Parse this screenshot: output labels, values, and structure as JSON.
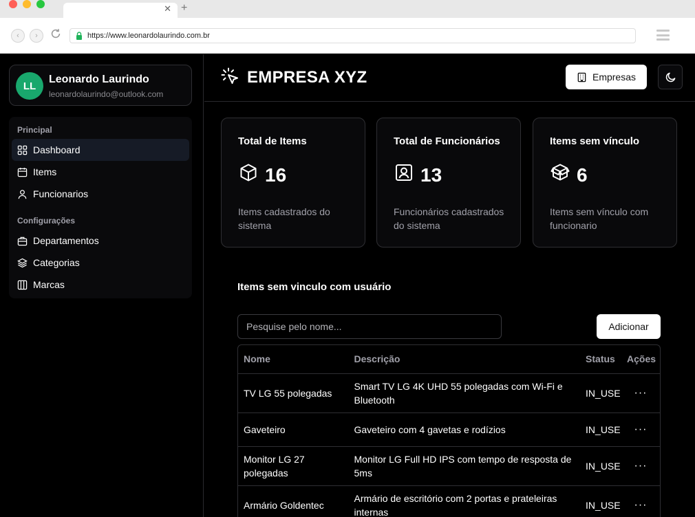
{
  "browser": {
    "url": "https://www.leonardolaurindo.com.br",
    "tab_close": "✕",
    "tab_new": "+"
  },
  "profile": {
    "initials": "LL",
    "name": "Leonardo Laurindo",
    "email": "leonardolaurindo@outlook.com"
  },
  "sidebar": {
    "sections": [
      {
        "title": "Principal",
        "items": [
          {
            "label": "Dashboard",
            "icon": "grid-icon",
            "active": true
          },
          {
            "label": "Items",
            "icon": "calendar-icon"
          },
          {
            "label": "Funcionarios",
            "icon": "user-icon"
          }
        ]
      },
      {
        "title": "Configurações",
        "items": [
          {
            "label": "Departamentos",
            "icon": "briefcase-icon"
          },
          {
            "label": "Categorias",
            "icon": "layers-icon"
          },
          {
            "label": "Marcas",
            "icon": "columns-icon"
          }
        ]
      }
    ]
  },
  "header": {
    "brand": "EMPRESA XYZ",
    "brand_icon": "cursor-click-icon",
    "empresas_label": "Empresas",
    "theme_icon": "moon-icon"
  },
  "cards": [
    {
      "title": "Total de Items",
      "value": "16",
      "desc": "Items cadastrados do sistema",
      "icon": "box-icon"
    },
    {
      "title": "Total de Funcionários",
      "value": "13",
      "desc": "Funcionários cadastrados do sistema",
      "icon": "contact-icon"
    },
    {
      "title": "Items sem vínculo",
      "value": "6",
      "desc": "Items sem vínculo com funcionario",
      "icon": "package-open-icon"
    }
  ],
  "items_section": {
    "title": "Items sem vinculo com usuário",
    "search_placeholder": "Pesquise pelo nome...",
    "add_label": "Adicionar",
    "columns": [
      "Nome",
      "Descrição",
      "Status",
      "Ações"
    ],
    "rows": [
      {
        "name": "TV LG 55 polegadas",
        "desc": "Smart TV LG 4K UHD 55 polegadas com Wi-Fi e Bluetooth",
        "status": "IN_USE",
        "actions": "···"
      },
      {
        "name": "Gaveteiro",
        "desc": "Gaveteiro com 4 gavetas e rodízios",
        "status": "IN_USE",
        "actions": "···"
      },
      {
        "name": "Monitor LG 27 polegadas",
        "desc": "Monitor LG Full HD IPS com tempo de resposta de 5ms",
        "status": "IN_USE",
        "actions": "···"
      },
      {
        "name": "Armário Goldentec",
        "desc": "Armário de escritório com 2 portas e prateleiras internas",
        "status": "IN_USE",
        "actions": "···"
      }
    ]
  },
  "colors": {
    "background": "#000000",
    "card": "#09090b",
    "border": "#2f2f33",
    "avatar": "#19a86d",
    "active_nav": "#161b26",
    "muted_text": "#a1a1aa"
  }
}
